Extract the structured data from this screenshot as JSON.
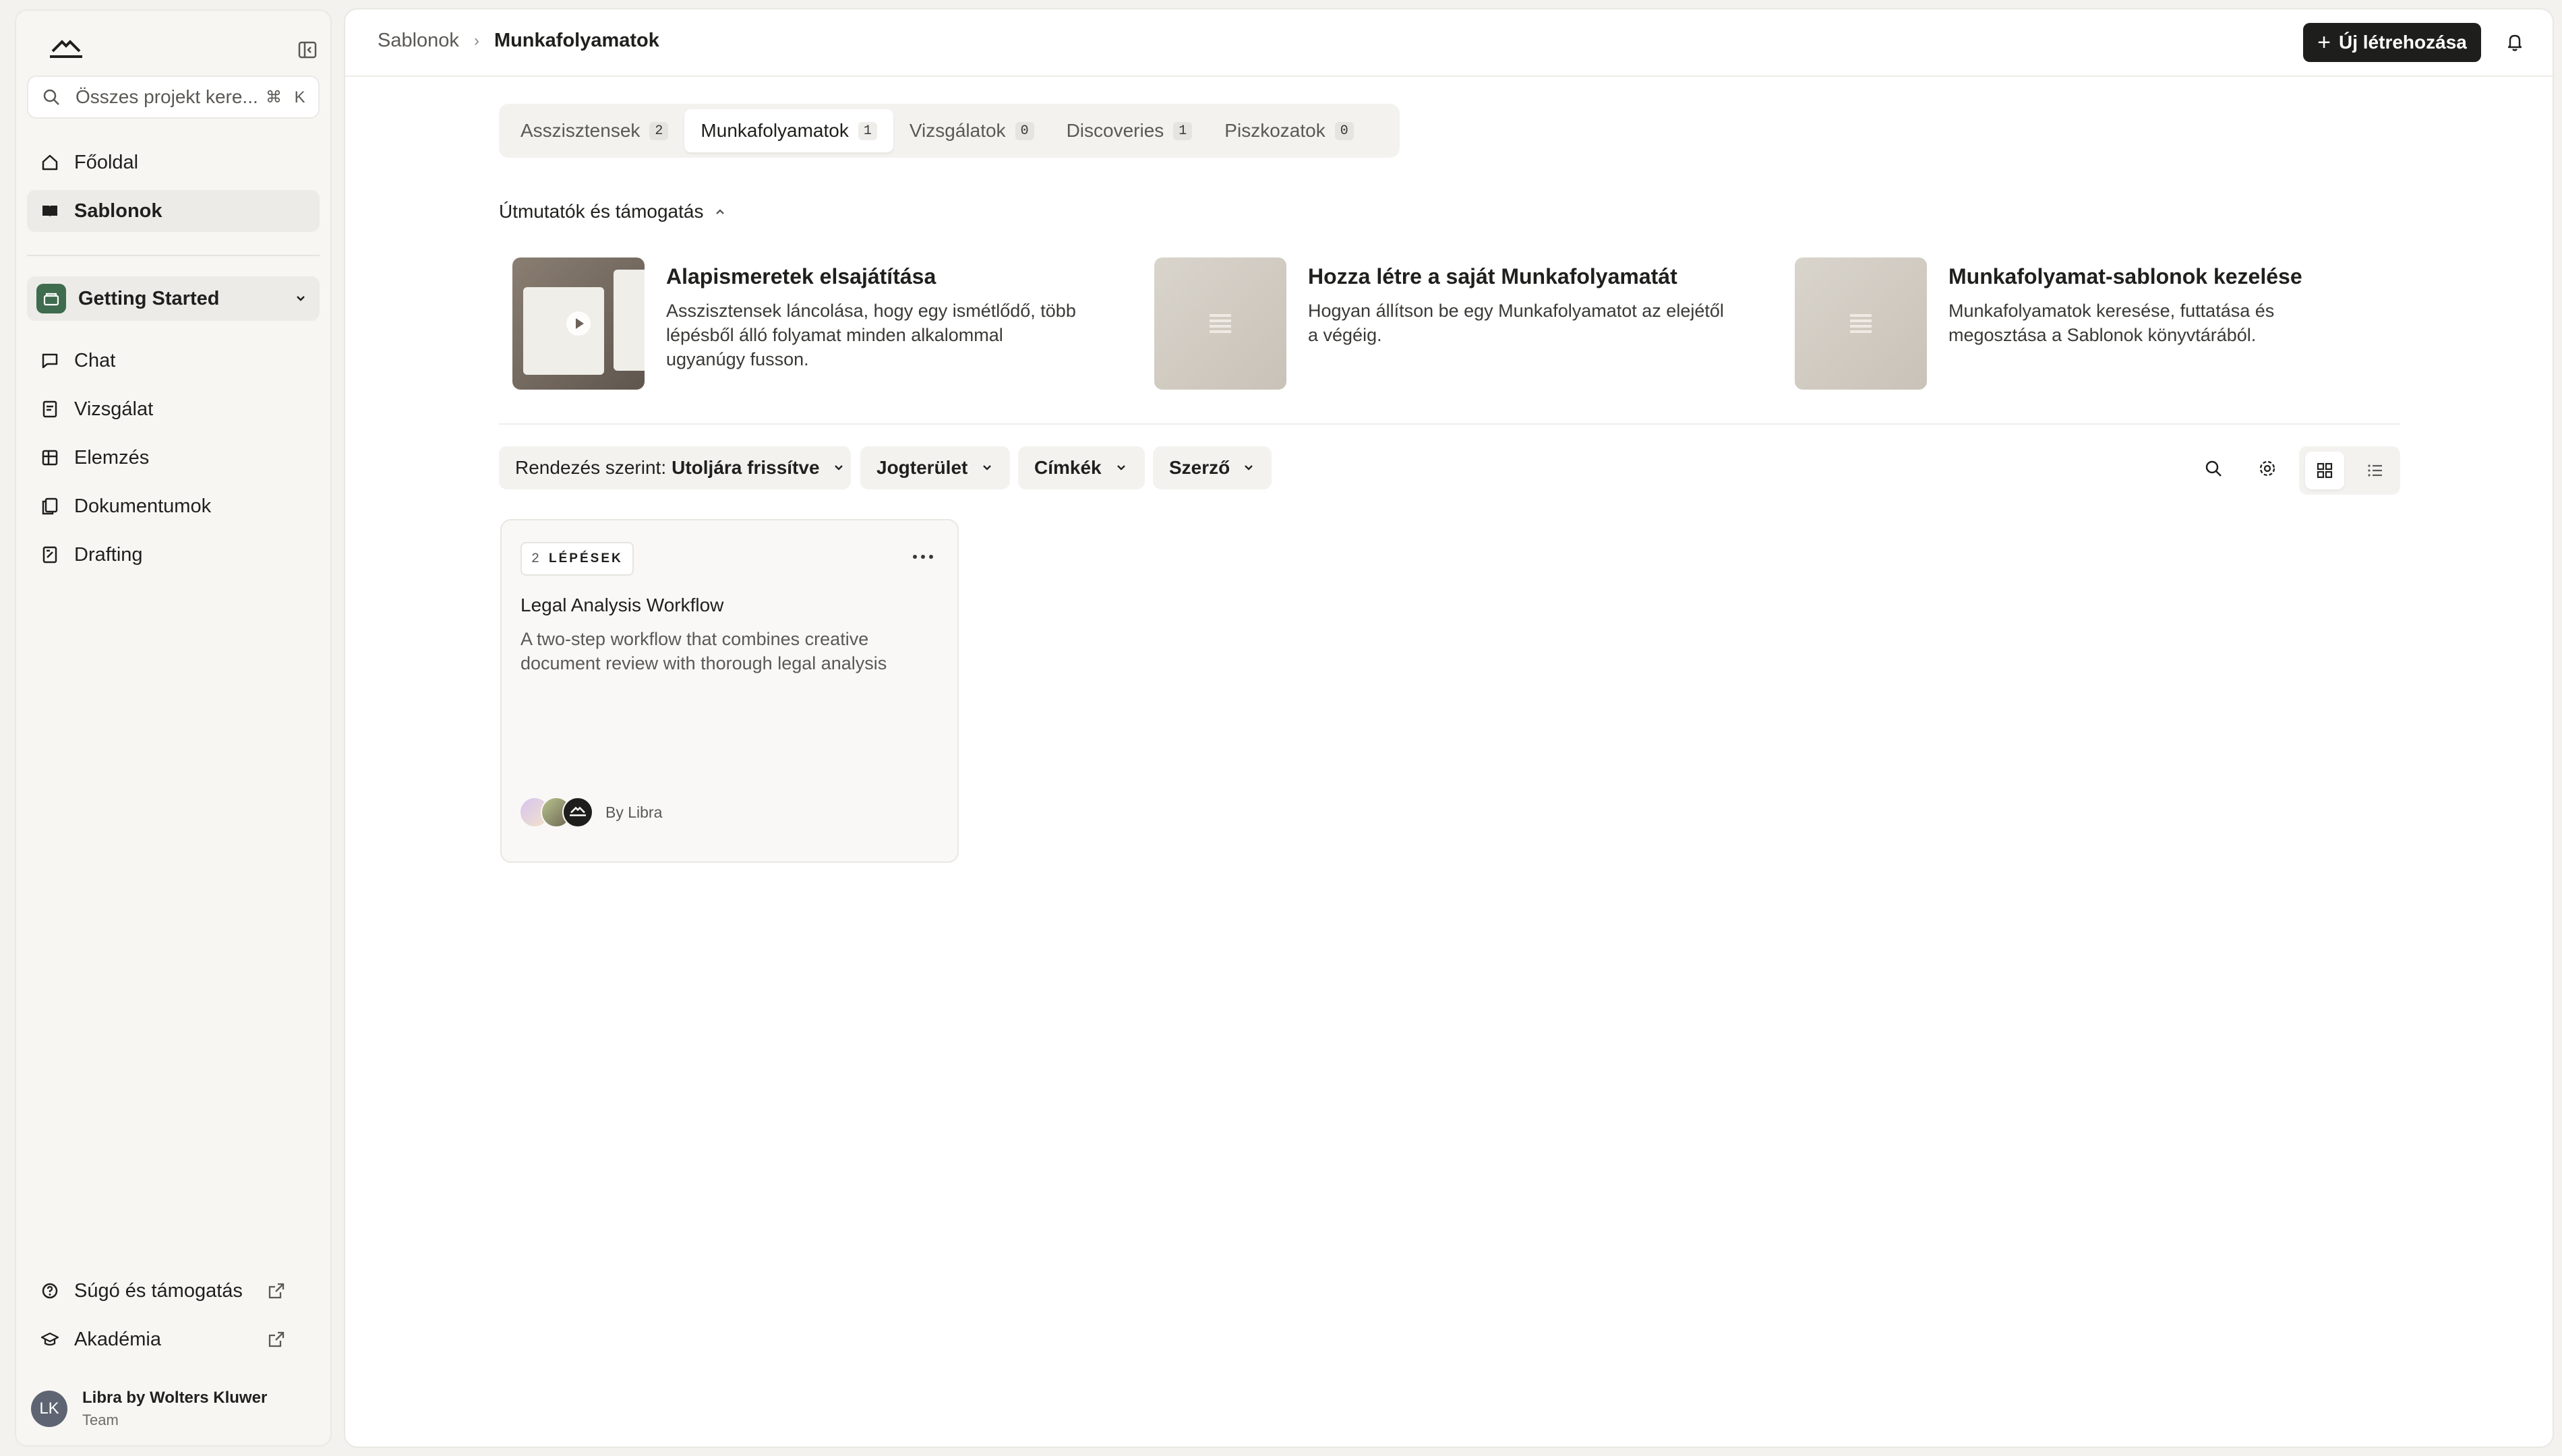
{
  "sidebar": {
    "search": {
      "placeholder": "Összes projekt kere...",
      "shortcut": "⌘ K"
    },
    "nav": [
      {
        "label": "Főoldal",
        "icon": "home-icon"
      },
      {
        "label": "Sablonok",
        "icon": "book-icon",
        "active": true
      }
    ],
    "project": {
      "name": "Getting Started"
    },
    "project_nav": [
      {
        "label": "Chat",
        "icon": "chat-icon"
      },
      {
        "label": "Vizsgálat",
        "icon": "review-icon"
      },
      {
        "label": "Elemzés",
        "icon": "table-icon"
      },
      {
        "label": "Dokumentumok",
        "icon": "documents-icon"
      },
      {
        "label": "Drafting",
        "icon": "drafting-icon"
      }
    ],
    "bottom": [
      {
        "label": "Súgó és támogatás",
        "icon": "help-icon"
      },
      {
        "label": "Akadémia",
        "icon": "academy-icon"
      }
    ],
    "user": {
      "initials": "LK",
      "name": "Libra by Wolters Kluwer",
      "team": "Team"
    }
  },
  "header": {
    "breadcrumb": [
      "Sablonok",
      "Munkafolyamatok"
    ],
    "new_button": "Új létrehozása"
  },
  "tabs": [
    {
      "label": "Asszisztensek",
      "count": "2"
    },
    {
      "label": "Munkafolyamatok",
      "count": "1",
      "active": true
    },
    {
      "label": "Vizsgálatok",
      "count": "0"
    },
    {
      "label": "Discoveries",
      "count": "1"
    },
    {
      "label": "Piszkozatok",
      "count": "0"
    }
  ],
  "guides": {
    "title": "Útmutatók és támogatás",
    "items": [
      {
        "title": "Alapismeretek elsajátítása",
        "desc": "Asszisztensek láncolása, hogy egy ismétlődő, több lépésből álló folyamat minden alkalommal ugyanúgy fusson."
      },
      {
        "title": "Hozza létre a saját Munkafolyamatát",
        "desc": "Hogyan állítson be egy Munkafolyamatot az elejétől a végéig."
      },
      {
        "title": "Munkafolyamat-sablonok kezelése",
        "desc": "Munkafolyamatok keresése, futtatása és megosztása a Sablonok könyvtárából."
      }
    ]
  },
  "filters": {
    "sort_label": "Rendezés szerint:",
    "sort_value": "Utoljára frissítve",
    "jurisdiction": "Jogterület",
    "tags": "Címkék",
    "author": "Szerző"
  },
  "cards": [
    {
      "steps_count": "2",
      "steps_label": "LÉPÉSEK",
      "title": "Legal Analysis Workflow",
      "desc": "A two-step workflow that combines creative document review with thorough legal analysis",
      "author": "By Libra"
    }
  ],
  "colors": {
    "primary_button": "#1e1f1d",
    "project_badge": "#3f6b4e",
    "avatar": "#5e6471"
  }
}
